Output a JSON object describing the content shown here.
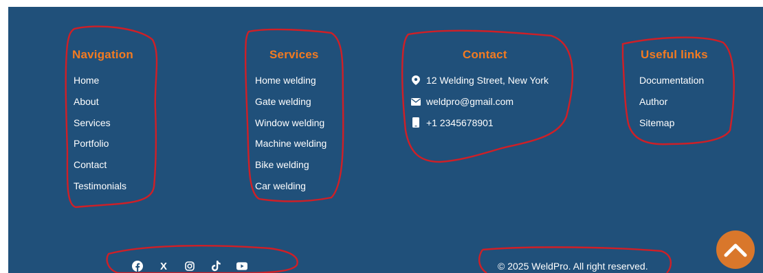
{
  "colors": {
    "footer_bg": "#20507a",
    "heading": "#f47b20",
    "text": "#ffffff",
    "scroll_button": "#d9772b",
    "annotation_ring": "#d01f26"
  },
  "navigation": {
    "title": "Navigation",
    "items": [
      "Home",
      "About",
      "Services",
      "Portfolio",
      "Contact",
      "Testimonials"
    ]
  },
  "services": {
    "title": "Services",
    "items": [
      "Home welding",
      "Gate welding",
      "Window welding",
      "Machine welding",
      "Bike welding",
      "Car welding"
    ]
  },
  "contact": {
    "title": "Contact",
    "items": [
      {
        "icon": "map-pin-icon",
        "text": "12 Welding Street, New York"
      },
      {
        "icon": "envelope-icon",
        "text": "weldpro@gmail.com"
      },
      {
        "icon": "phone-icon",
        "text": "+1 2345678901"
      }
    ]
  },
  "useful_links": {
    "title": "Useful links",
    "items": [
      "Documentation",
      "Author",
      "Sitemap"
    ]
  },
  "social": {
    "icons": [
      "facebook-icon",
      "x-icon",
      "instagram-icon",
      "tiktok-icon",
      "youtube-icon"
    ],
    "x_glyph": "X"
  },
  "copyright": "© 2025 WeldPro. All right reserved.",
  "scroll_top": {
    "icon": "chevron-up-icon"
  }
}
